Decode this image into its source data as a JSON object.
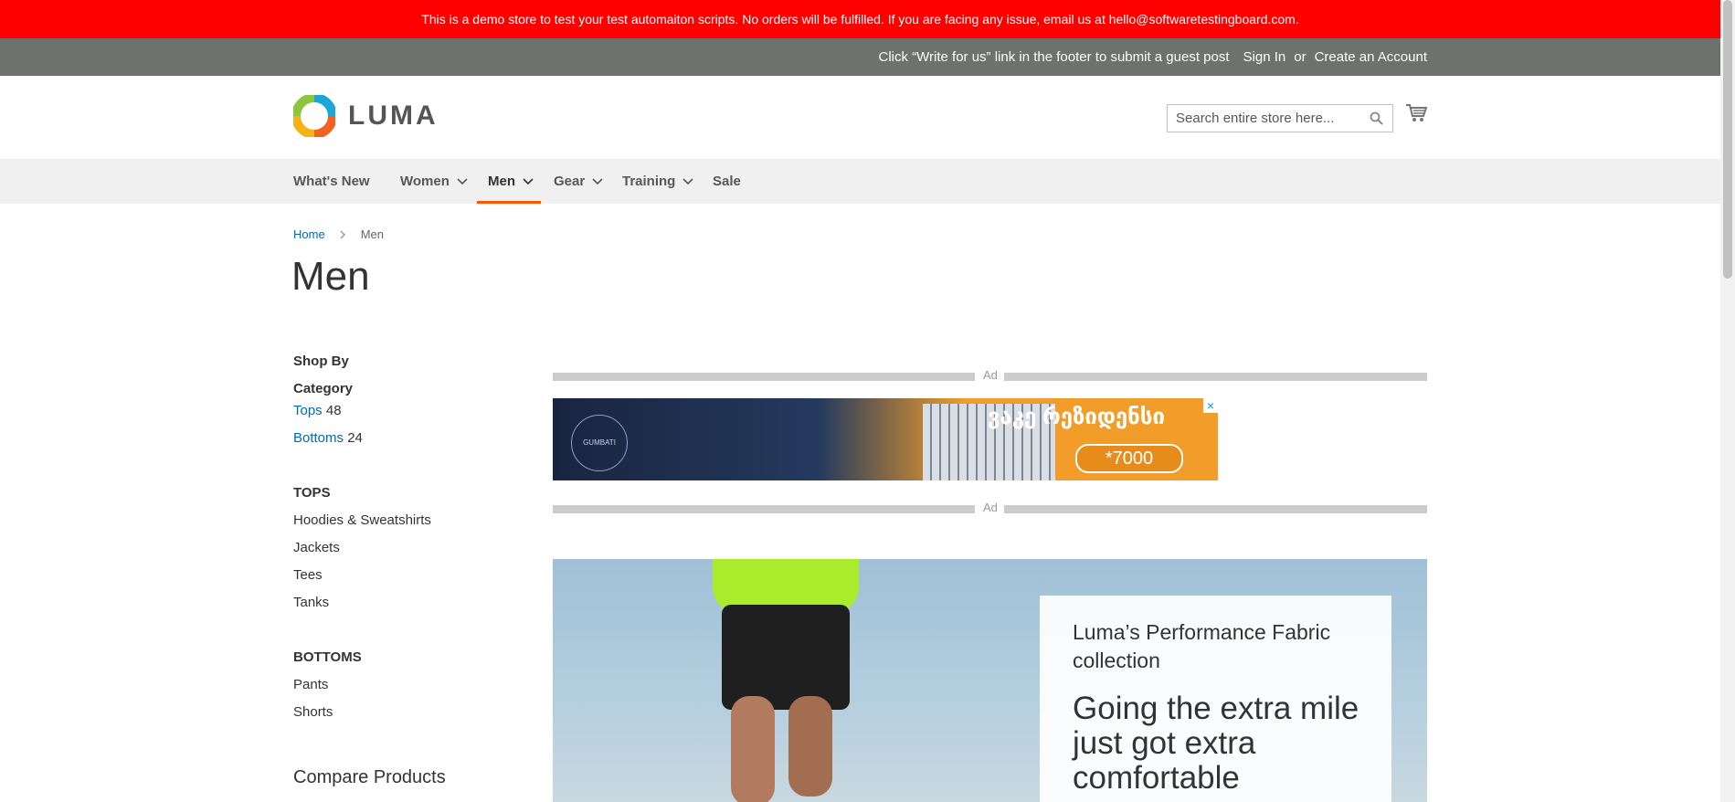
{
  "demo_notice": "This is a demo store to test your test automaiton scripts. No orders will be fulfilled. If you are facing any issue, email us at hello@softwaretestingboard.com.",
  "header_panel": {
    "note": "Click “Write for us” link in the footer to submit a guest post",
    "sign_in": "Sign In",
    "or": "or",
    "create_account": "Create an Account"
  },
  "logo": {
    "text": "LUMA"
  },
  "search": {
    "placeholder": "Search entire store here..."
  },
  "nav": {
    "items": [
      {
        "label": "What's New"
      },
      {
        "label": "Women"
      },
      {
        "label": "Men"
      },
      {
        "label": "Gear"
      },
      {
        "label": "Training"
      },
      {
        "label": "Sale"
      }
    ],
    "active": "Men"
  },
  "breadcrumb": {
    "home": "Home",
    "current": "Men"
  },
  "page_title": "Men",
  "sidebar": {
    "shop_by": "Shop By",
    "category_title": "Category",
    "categories": [
      {
        "label": "Tops",
        "count": "48"
      },
      {
        "label": "Bottoms",
        "count": "24"
      }
    ],
    "tops_title": "TOPS",
    "tops": [
      "Hoodies & Sweatshirts",
      "Jackets",
      "Tees",
      "Tanks"
    ],
    "bottoms_title": "BOTTOMS",
    "bottoms": [
      "Pants",
      "Shorts"
    ],
    "compare_title": "Compare Products"
  },
  "ad": {
    "label": "Ad",
    "close": "×",
    "headline": "ვაკე რეზიდენსი",
    "phone": "*7000",
    "logo_text": "GUMBATI HOLDING"
  },
  "hero": {
    "subtitle": "Luma’s Performance Fabric collection",
    "title": "Going the extra mile just got extra comfortable"
  },
  "colors": {
    "banner": "#ff0000",
    "panel": "#6e716e",
    "nav_bg": "#f0f0f0",
    "nav_active": "#ff5501",
    "link": "#006bb4"
  }
}
